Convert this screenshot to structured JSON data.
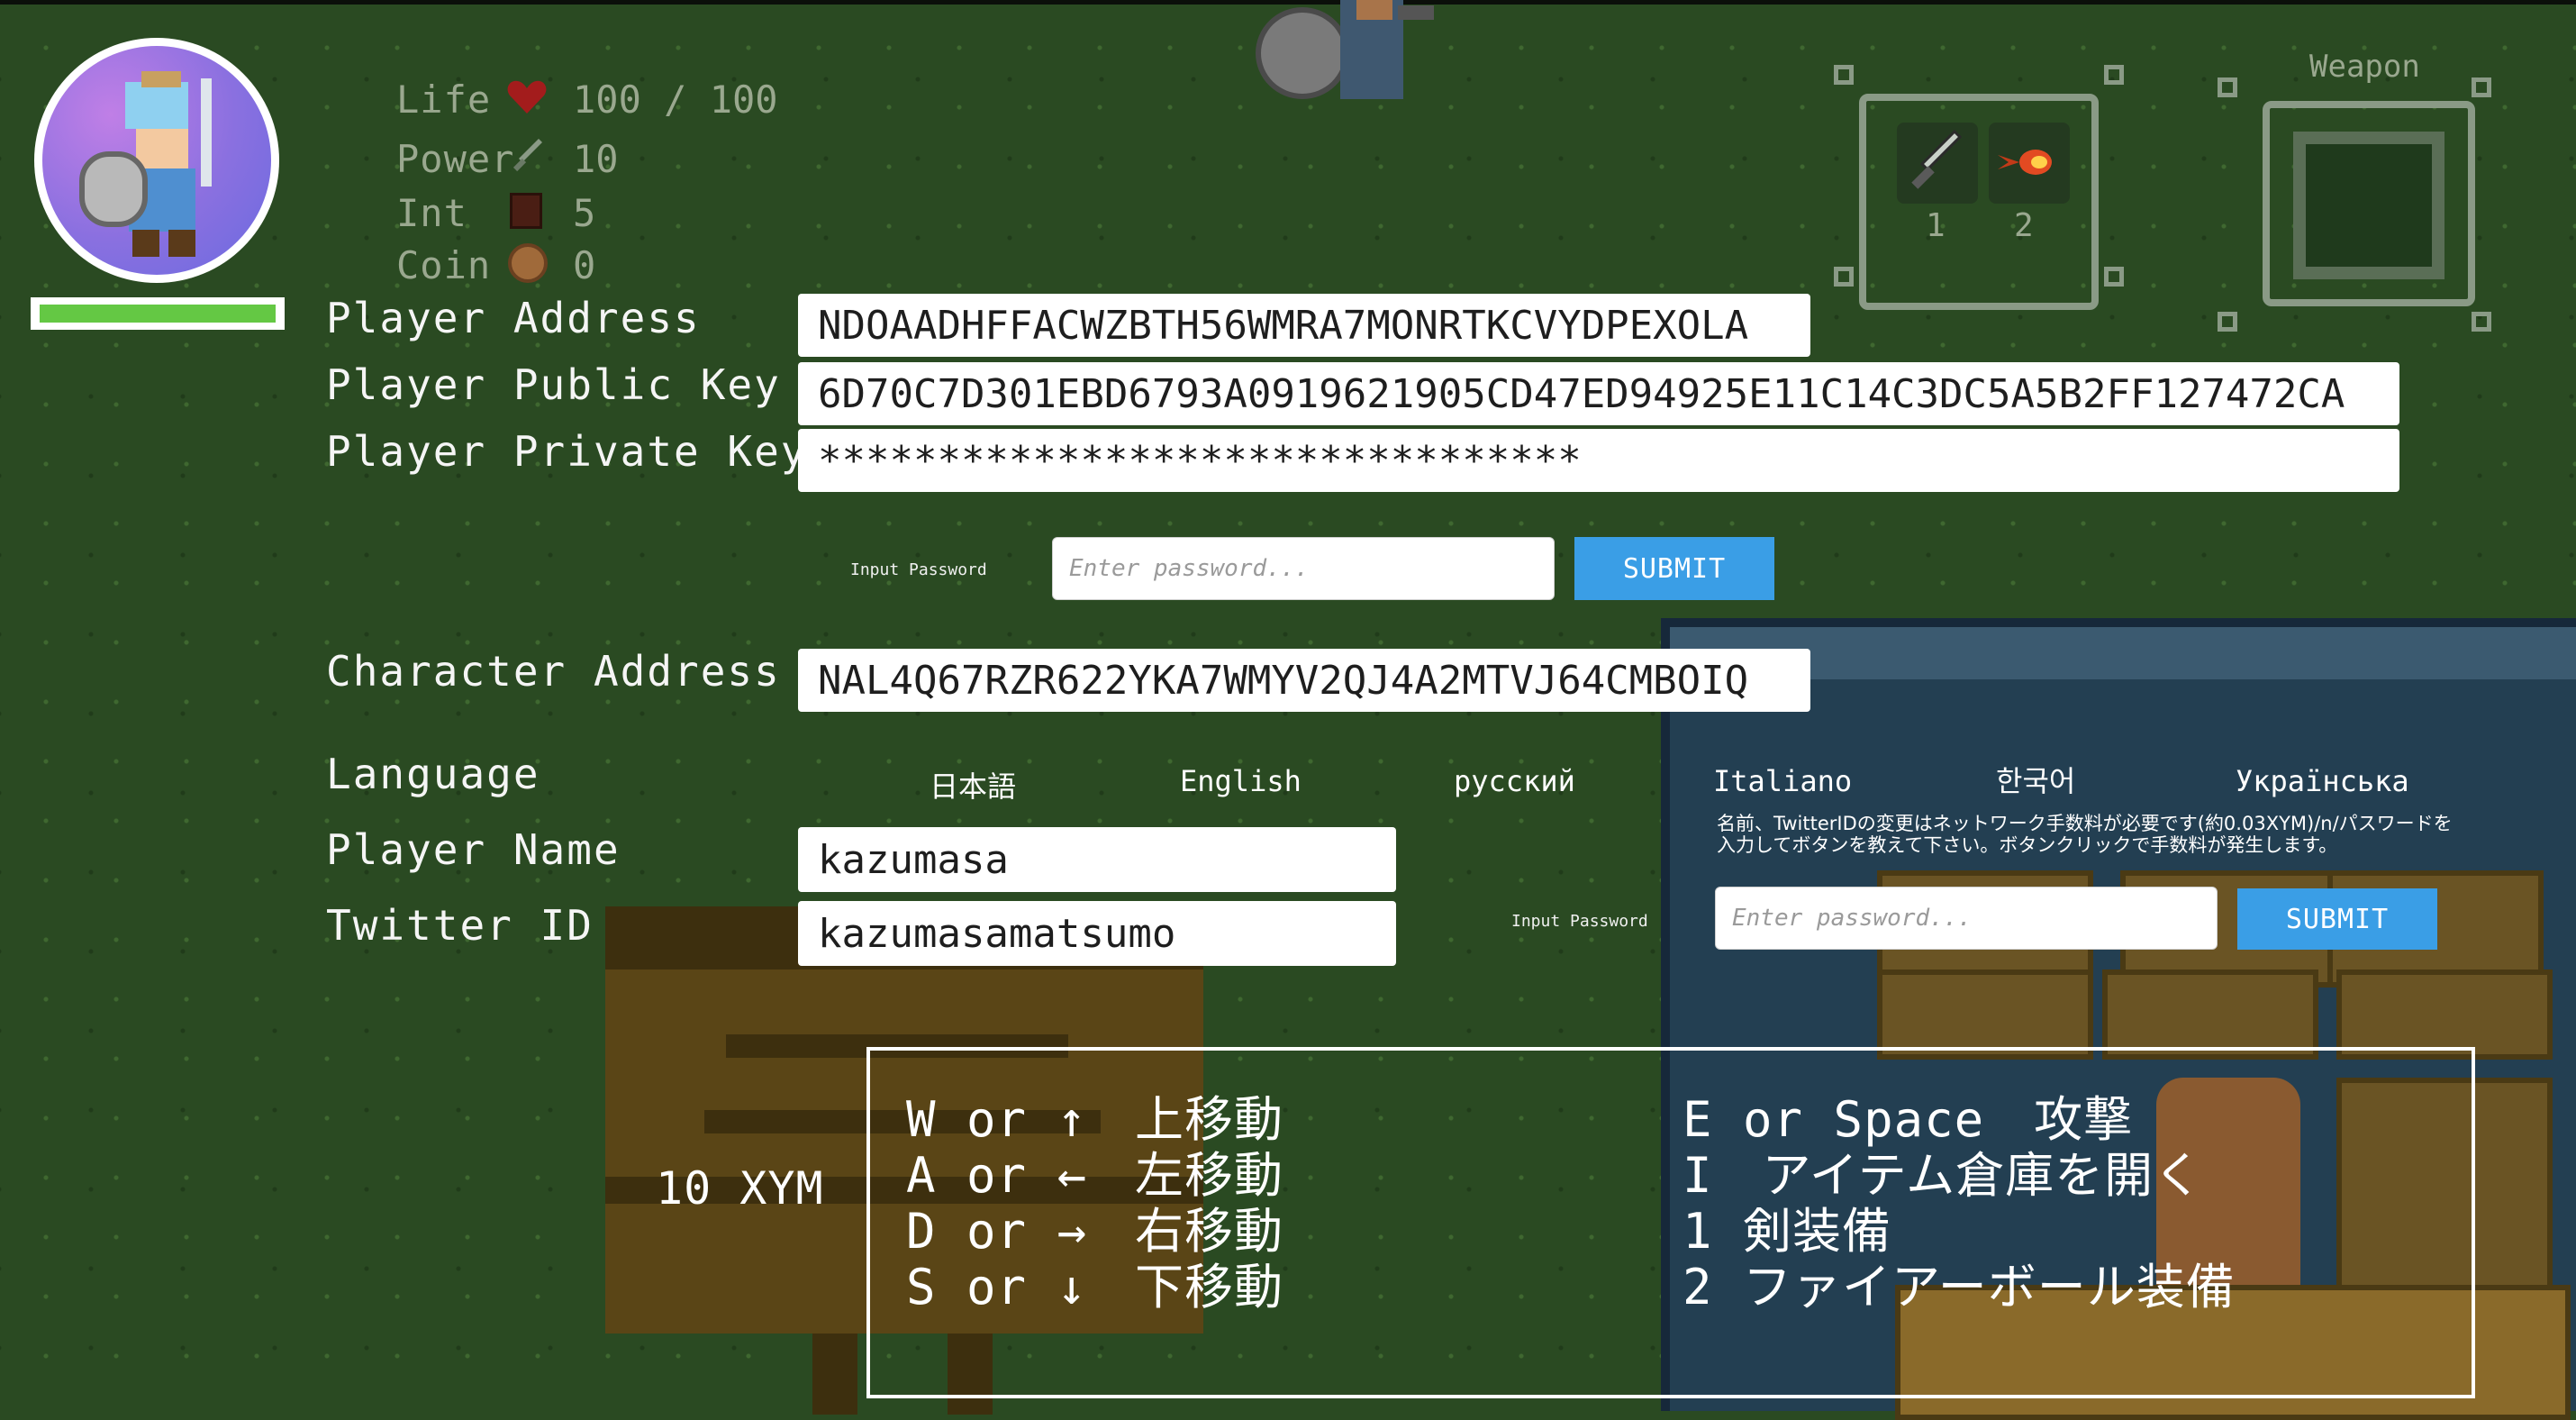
{
  "hud": {
    "stats": [
      {
        "label": "Life",
        "icon": "heart-icon",
        "value": "100 / 100"
      },
      {
        "label": "Power",
        "icon": "sword-icon",
        "value": "10"
      },
      {
        "label": "Int",
        "icon": "book-icon",
        "value": "5"
      },
      {
        "label": "Coin",
        "icon": "coin-icon",
        "value": "0"
      }
    ],
    "hp_fraction": 1.0,
    "weapon_label": "Weapon",
    "slots": [
      {
        "number": "1",
        "icon": "sword-icon"
      },
      {
        "number": "2",
        "icon": "fireball-icon"
      }
    ]
  },
  "form": {
    "player_address_label": "Player Address",
    "player_address_value": "NDOAADHFFACWZBTH56WMRA7MONRTKCVYDPEXOLA",
    "player_public_key_label": "Player Public Key",
    "player_public_key_value": "6D70C7D301EBD6793A0919621905CD47ED94925E11C14C3DC5A5B2FF127472CA",
    "player_private_key_label": "Player Private Key",
    "player_private_key_value": "********************************",
    "password_label": "Input Password",
    "password_placeholder": "Enter password...",
    "submit_label": "SUBMIT",
    "character_address_label": "Character Address",
    "character_address_value": "NAL4Q67RZR622YKA7WMYV2QJ4A2MTVJ64CMBOIQ",
    "language_label": "Language",
    "languages": [
      "日本語",
      "English",
      "русский",
      "Italiano",
      "한국어",
      "Українська"
    ],
    "notice": "名前、TwitterIDの変更はネットワーク手数料が必要です(約0.03XYM)/n/パスワードを入力してボタンを教えて下さい。ボタンクリックで手数料が発生します。",
    "player_name_label": "Player Name",
    "player_name_value": "kazumasa",
    "twitter_id_label": "Twitter ID",
    "twitter_id_value": "kazumasamatsumo",
    "password_label_2": "Input Password",
    "password_placeholder_2": "Enter password...",
    "submit_label_2": "SUBMIT"
  },
  "sign": {
    "text": "10 XYM"
  },
  "controls": {
    "left": [
      {
        "key": "W or ↑",
        "action": "上移動"
      },
      {
        "key": "A or ←",
        "action": "左移動"
      },
      {
        "key": "D or →",
        "action": "右移動"
      },
      {
        "key": "S or ↓",
        "action": "下移動"
      }
    ],
    "right": [
      "E or Space　攻撃",
      "I　アイテム倉庫を開く",
      "1 剣装備",
      "2 ファイアーボール装備"
    ]
  },
  "colors": {
    "background": "#2a4a22",
    "submit": "#3a9ee6",
    "hp_bar": "#64c844",
    "heart": "#a31c1c"
  }
}
